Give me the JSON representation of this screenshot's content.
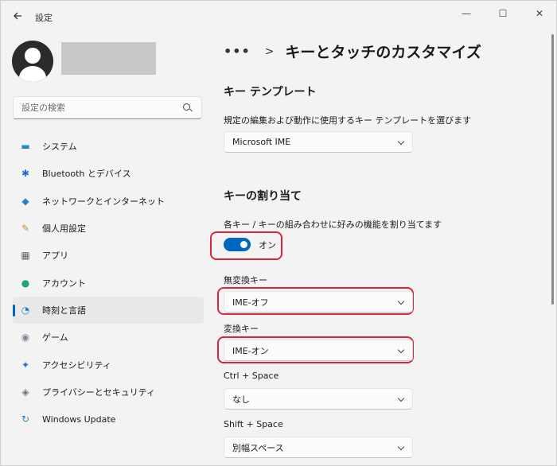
{
  "window": {
    "title": "設定",
    "back_icon": "back-arrow-icon",
    "controls": {
      "minimize": "—",
      "maximize": "☐",
      "close": "✕"
    }
  },
  "search": {
    "placeholder": "設定の検索"
  },
  "sidebar": {
    "items": [
      {
        "label": "システム",
        "icon": "monitor-icon",
        "glyph": "▬",
        "color": "#1e88c7"
      },
      {
        "label": "Bluetooth とデバイス",
        "icon": "bluetooth-icon",
        "glyph": "✱",
        "color": "#1e6fd0"
      },
      {
        "label": "ネットワークとインターネット",
        "icon": "wifi-icon",
        "glyph": "◆",
        "color": "#1e88c7"
      },
      {
        "label": "個人用設定",
        "icon": "brush-icon",
        "glyph": "✎",
        "color": "#d08a3a"
      },
      {
        "label": "アプリ",
        "icon": "apps-icon",
        "glyph": "▦",
        "color": "#5a6878"
      },
      {
        "label": "アカウント",
        "icon": "account-icon",
        "glyph": "●",
        "color": "#1fa37a"
      },
      {
        "label": "時刻と言語",
        "icon": "globe-clock-icon",
        "glyph": "◔",
        "color": "#1e88c7"
      },
      {
        "label": "ゲーム",
        "icon": "gamepad-icon",
        "glyph": "◉",
        "color": "#7a8a9a"
      },
      {
        "label": "アクセシビリティ",
        "icon": "accessibility-icon",
        "glyph": "✦",
        "color": "#1e6fd0"
      },
      {
        "label": "プライバシーとセキュリティ",
        "icon": "shield-icon",
        "glyph": "◈",
        "color": "#6a7480"
      },
      {
        "label": "Windows Update",
        "icon": "update-icon",
        "glyph": "↻",
        "color": "#1e88c7"
      }
    ],
    "active_index": 6,
    "active_color": "#0067c0"
  },
  "breadcrumb": {
    "dots": "•••",
    "separator": ">",
    "title": "キーとタッチのカスタマイズ"
  },
  "key_template": {
    "heading": "キー テンプレート",
    "description": "規定の編集および動作に使用するキー テンプレートを選びます",
    "value": "Microsoft IME"
  },
  "key_assignment": {
    "heading": "キーの割り当て",
    "description": "各キー / キーの組み合わせに好みの機能を割り当てます",
    "toggle_state": "オン",
    "toggle_on": true,
    "toggle_color": "#0067c0"
  },
  "keys": [
    {
      "label": "無変換キー",
      "value": "IME-オフ"
    },
    {
      "label": "変換キー",
      "value": "IME-オン"
    },
    {
      "label": "Ctrl + Space",
      "value": "なし"
    },
    {
      "label": "Shift + Space",
      "value": "別幅スペース"
    }
  ],
  "highlight_color": "#d7263d"
}
